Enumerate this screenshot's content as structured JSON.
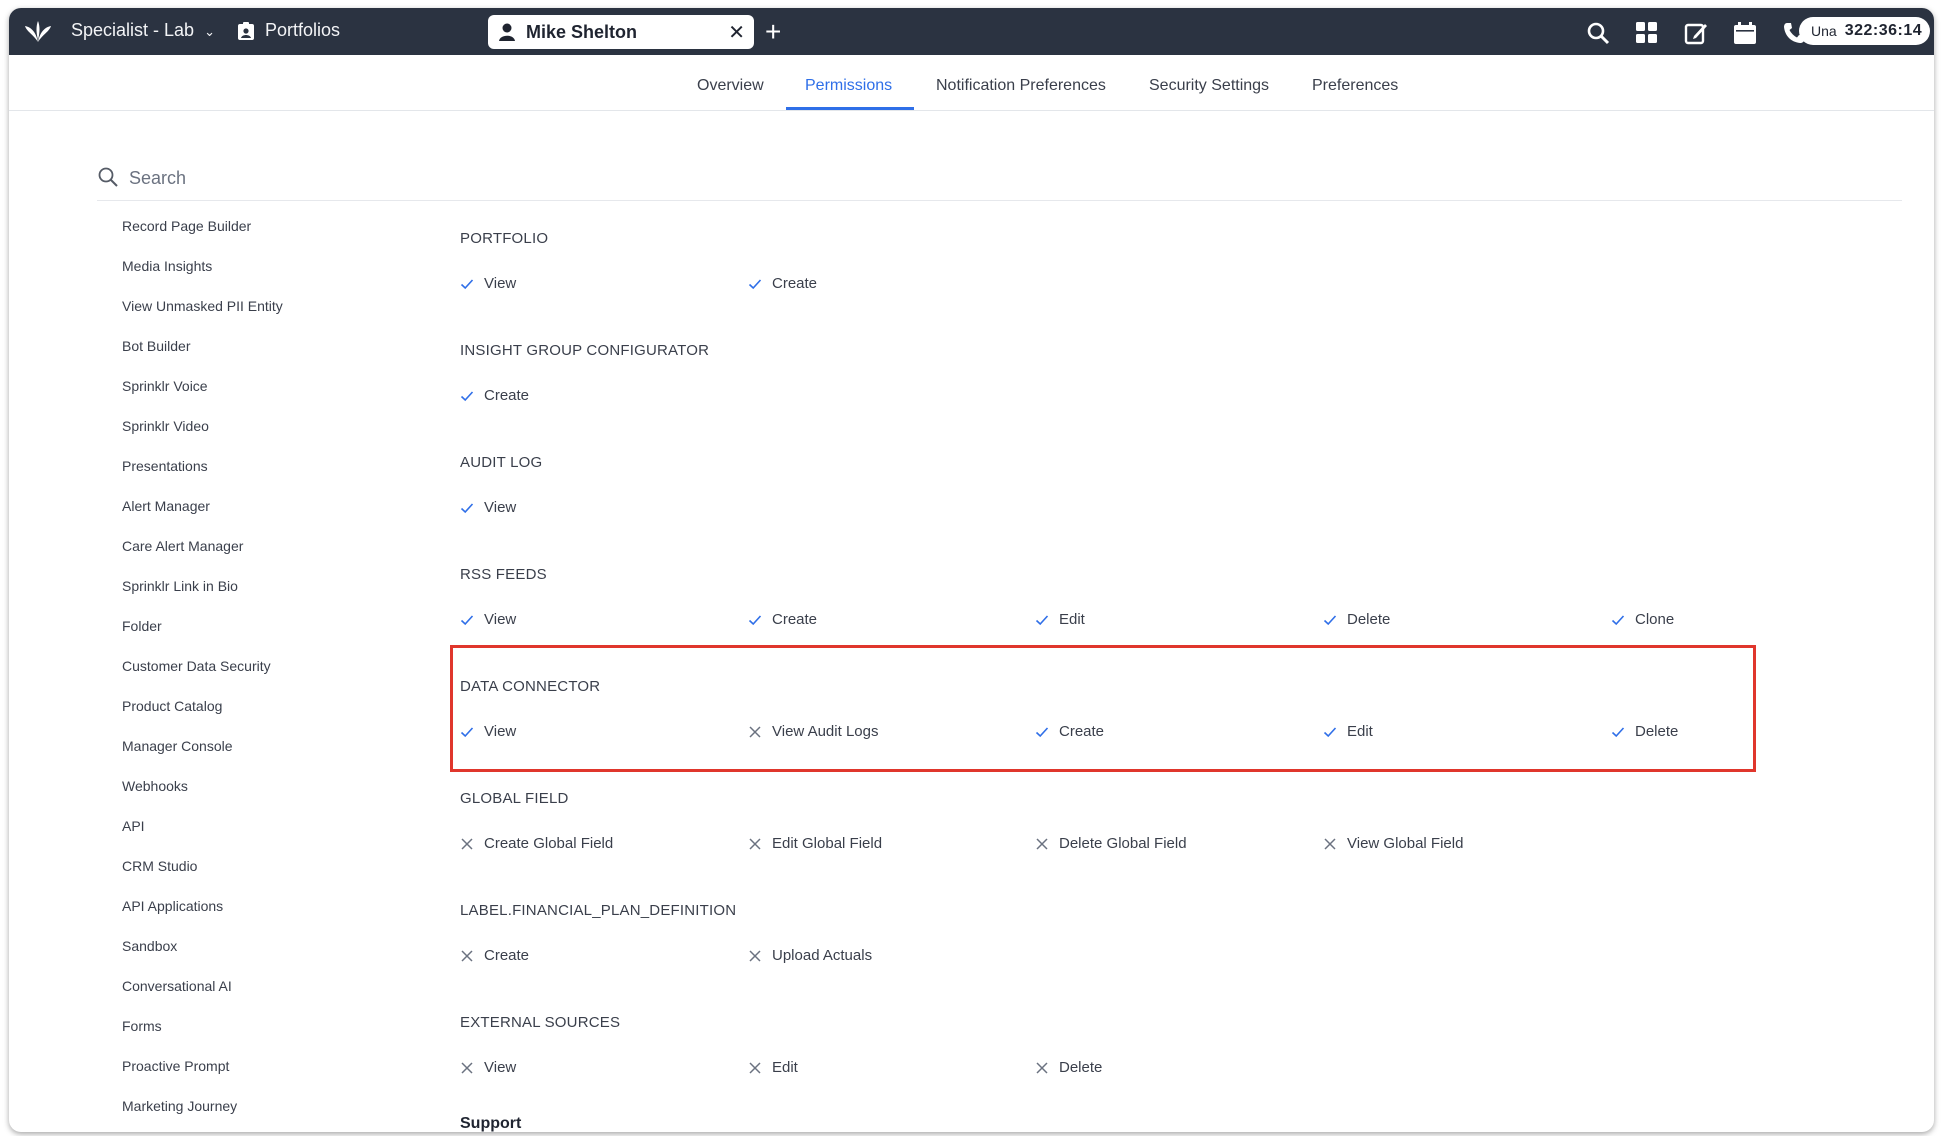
{
  "topbar": {
    "app_title": "Specialist - Lab",
    "module": "Portfolios",
    "open_tab": "Mike Shelton",
    "timer_user": "Una",
    "timer_time": "322:36:14"
  },
  "subnav": {
    "tabs": [
      "Overview",
      "Permissions",
      "Notification Preferences",
      "Security Settings",
      "Preferences"
    ],
    "active": "Permissions"
  },
  "search": {
    "placeholder": "Search"
  },
  "sidebar": {
    "items": [
      "Record Page Builder",
      "Media Insights",
      "View Unmasked PII Entity",
      "Bot Builder",
      "Sprinklr Voice",
      "Sprinklr Video",
      "Presentations",
      "Alert Manager",
      "Care Alert Manager",
      "Sprinklr Link in Bio",
      "Folder",
      "Customer Data Security",
      "Product Catalog",
      "Manager Console",
      "Webhooks",
      "API",
      "CRM Studio",
      "API Applications",
      "Sandbox",
      "Conversational AI",
      "Forms",
      "Proactive Prompt",
      "Marketing Journey"
    ]
  },
  "sections": [
    {
      "title": "PORTFOLIO",
      "perms": [
        {
          "label": "View",
          "granted": true
        },
        {
          "label": "Create",
          "granted": true
        }
      ]
    },
    {
      "title": "INSIGHT GROUP CONFIGURATOR",
      "perms": [
        {
          "label": "Create",
          "granted": true
        }
      ]
    },
    {
      "title": "AUDIT LOG",
      "perms": [
        {
          "label": "View",
          "granted": true
        }
      ]
    },
    {
      "title": "RSS FEEDS",
      "perms": [
        {
          "label": "View",
          "granted": true
        },
        {
          "label": "Create",
          "granted": true
        },
        {
          "label": "Edit",
          "granted": true
        },
        {
          "label": "Delete",
          "granted": true
        },
        {
          "label": "Clone",
          "granted": true
        }
      ]
    },
    {
      "title": "DATA CONNECTOR",
      "perms": [
        {
          "label": "View",
          "granted": true
        },
        {
          "label": "View Audit Logs",
          "granted": false
        },
        {
          "label": "Create",
          "granted": true
        },
        {
          "label": "Edit",
          "granted": true
        },
        {
          "label": "Delete",
          "granted": true
        }
      ]
    },
    {
      "title": "GLOBAL FIELD",
      "perms": [
        {
          "label": "Create Global Field",
          "granted": false
        },
        {
          "label": "Edit Global Field",
          "granted": false
        },
        {
          "label": "Delete Global Field",
          "granted": false
        },
        {
          "label": "View Global Field",
          "granted": false
        }
      ]
    },
    {
      "title": "LABEL.FINANCIAL_PLAN_DEFINITION",
      "perms": [
        {
          "label": "Create",
          "granted": false
        },
        {
          "label": "Upload Actuals",
          "granted": false
        }
      ]
    },
    {
      "title": "EXTERNAL SOURCES",
      "perms": [
        {
          "label": "View",
          "granted": false
        },
        {
          "label": "Edit",
          "granted": false
        },
        {
          "label": "Delete",
          "granted": false
        }
      ]
    }
  ],
  "support_title": "Support",
  "colors": {
    "accent": "#2f6fe8",
    "topbar": "#2b3341",
    "highlight": "#e0362c"
  }
}
